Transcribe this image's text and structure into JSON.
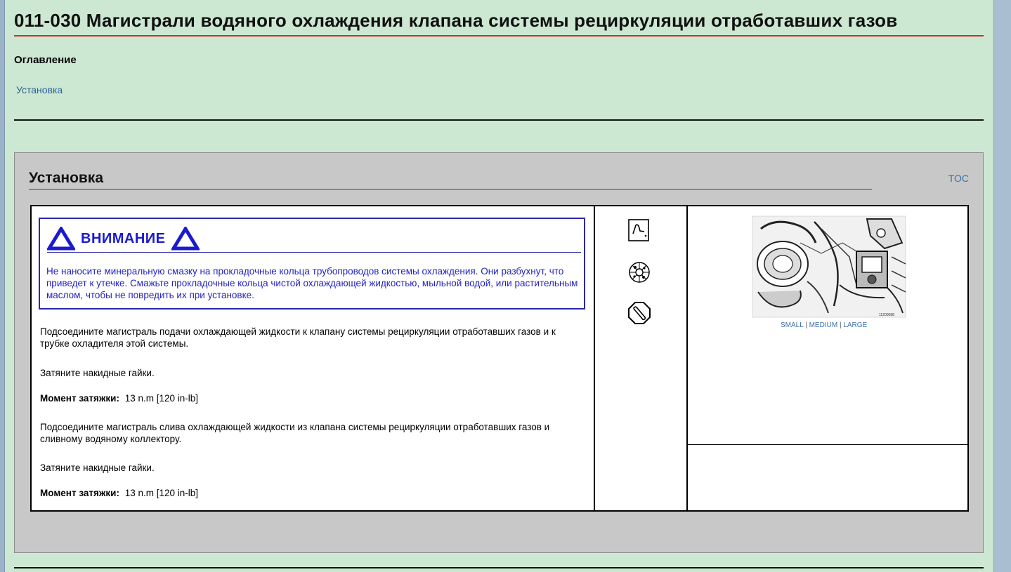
{
  "page": {
    "title": "011-030   Магистрали водяного охлаждения клапана системы рециркуляции отработавших газов"
  },
  "toc": {
    "heading": "Оглавление",
    "items": [
      {
        "label": "Установка"
      }
    ]
  },
  "section": {
    "title": "Установка",
    "toc_link": "TOC",
    "warning": {
      "title": "ВНИМАНИЕ",
      "body": "Не наносите минеральную смазку на прокладочные кольца трубопроводов системы охлаждения. Они разбухнут, что приведет к утечке. Смажьте прокладочные кольца чистой охлаждающей жидкостью, мыльной водой, или растительным маслом, чтобы не повредить их при установке."
    },
    "steps": [
      {
        "text": "Подсоедините магистраль подачи охлаждающей жидкости к клапану системы рециркуляции отработавших газов и к трубке охладителя этой системы."
      },
      {
        "text": "Затяните накидные гайки."
      },
      {
        "label": "Момент затяжки:",
        "value": "13  n.m  [120 in-lb]"
      },
      {
        "text": "Подсоедините магистраль слива охлаждающей жидкости из клапана системы рециркуляции отработавших газов и сливному водяному коллектору."
      },
      {
        "text": "Затяните накидные гайки."
      },
      {
        "label": "Момент затяжки:",
        "value": "13  n.m  [120 in-lb]"
      }
    ],
    "icons": [
      "wrench-tool-icon",
      "o-ring-lubrication-icon",
      "torque-wrench-icon"
    ],
    "image": {
      "caption_code": "11200088",
      "sizes": [
        "SMALL",
        "MEDIUM",
        "LARGE"
      ],
      "separator": "|"
    }
  },
  "colors": {
    "page_background": "#cde8d2",
    "title_rule": "#c8322f",
    "link": "#2d5f9a",
    "warning": "#1a1ad0",
    "panel": "#c8c8c8"
  }
}
